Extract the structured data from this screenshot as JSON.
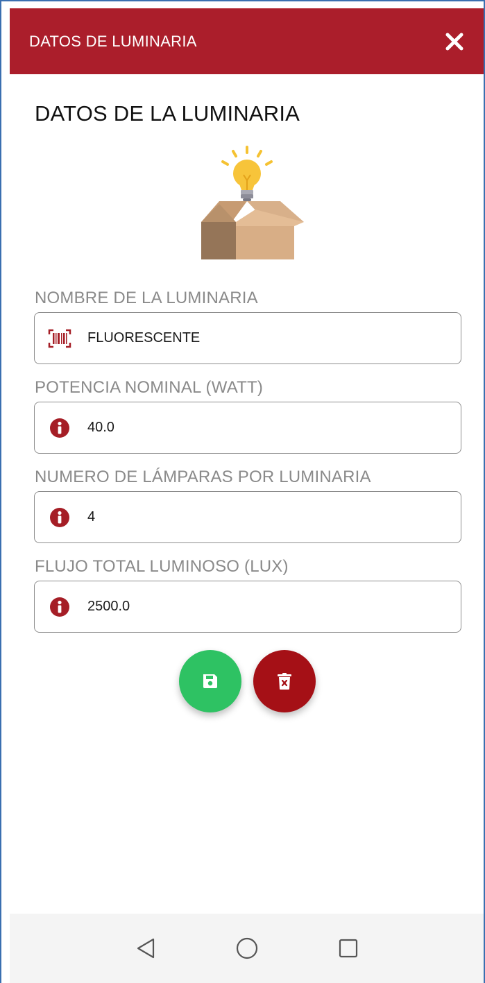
{
  "appbar": {
    "title": "DATOS DE LUMINARIA",
    "close_icon": "close-icon"
  },
  "heading": "DATOS DE LA LUMINARIA",
  "colors": {
    "primary": "#ab1e2b",
    "save": "#2ec263",
    "delete": "#a51016",
    "info": "#a51e26"
  },
  "fields": [
    {
      "label": "NOMBRE DE LA LUMINARIA",
      "value": "FLUORESCENTE",
      "icon": "barcode-icon"
    },
    {
      "label": "POTENCIA NOMINAL (WATT)",
      "value": "40.0",
      "icon": "info-icon"
    },
    {
      "label": "NUMERO DE LÁMPARAS POR LUMINARIA",
      "value": "4",
      "icon": "info-icon"
    },
    {
      "label": "FLUJO TOTAL LUMINOSO (LUX)",
      "value": "2500.0",
      "icon": "info-icon"
    }
  ],
  "actions": {
    "save_icon": "save-icon",
    "delete_icon": "delete-icon"
  },
  "navigation": {
    "back_icon": "back-triangle-icon",
    "home_icon": "home-circle-icon",
    "recents_icon": "recents-square-icon"
  }
}
